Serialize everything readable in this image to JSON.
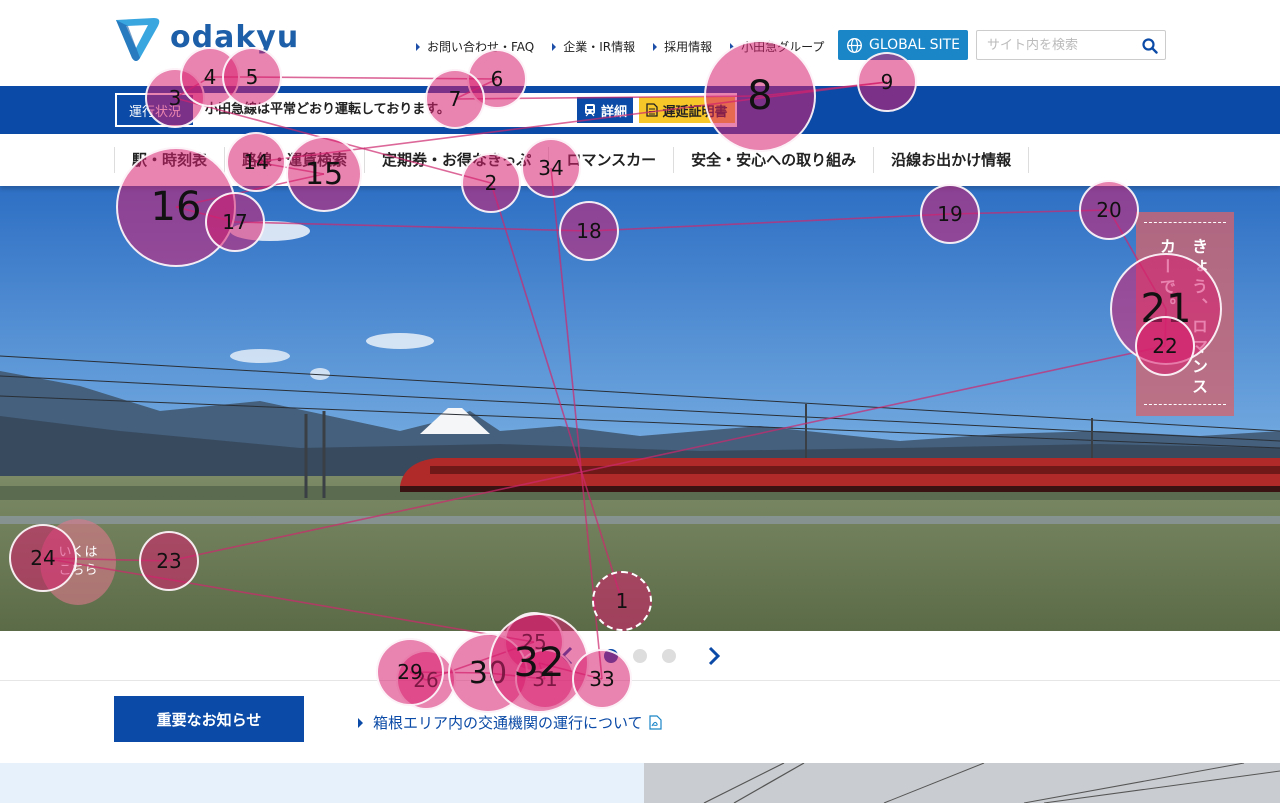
{
  "header": {
    "logo_text": "odakyu",
    "util_links": [
      "お問い合わせ・FAQ",
      "企業・IR情報",
      "採用情報",
      "小田急グループ"
    ],
    "global_label": "GLOBAL SITE",
    "search_placeholder": "サイト内を検索"
  },
  "status": {
    "label": "運行状況",
    "message": "小田急線は平常どおり運転しております。",
    "detail_label": "詳細",
    "delay_label": "遅延証明書"
  },
  "main_nav": [
    "駅・時刻表",
    "路線・運賃検索",
    "定期券・お得なきっぷ",
    "ロマンスカー",
    "安全・安心への取り組み",
    "沿線お出かけ情報"
  ],
  "hero": {
    "ticket_text": "きょう、ロマンスカーで。",
    "circle_text_1": "いくは",
    "circle_text_2": "こちら"
  },
  "carousel": {
    "total_dots": 3,
    "active_index": 0
  },
  "notice": {
    "button_label": "重要なお知らせ",
    "link_text": "箱根エリア内の交通機関の運行について"
  },
  "colors": {
    "brand_blue": "#0b4aa6",
    "global_blue": "#1a86c8",
    "delay_yellow": "#f7c72a",
    "gaze_pink": "#d71e6e"
  },
  "gaze_fixations": [
    {
      "n": "1"
    },
    {
      "n": "2"
    },
    {
      "n": "3"
    },
    {
      "n": "4"
    },
    {
      "n": "5"
    },
    {
      "n": "6"
    },
    {
      "n": "7"
    },
    {
      "n": "8"
    },
    {
      "n": "9"
    },
    {
      "n": "14"
    },
    {
      "n": "15"
    },
    {
      "n": "16"
    },
    {
      "n": "17"
    },
    {
      "n": "18"
    },
    {
      "n": "19"
    },
    {
      "n": "20"
    },
    {
      "n": "21"
    },
    {
      "n": "22"
    },
    {
      "n": "23"
    },
    {
      "n": "24"
    },
    {
      "n": "25"
    },
    {
      "n": "26"
    },
    {
      "n": "29"
    },
    {
      "n": "30"
    },
    {
      "n": "31"
    },
    {
      "n": "32"
    },
    {
      "n": "33"
    },
    {
      "n": "34"
    }
  ]
}
